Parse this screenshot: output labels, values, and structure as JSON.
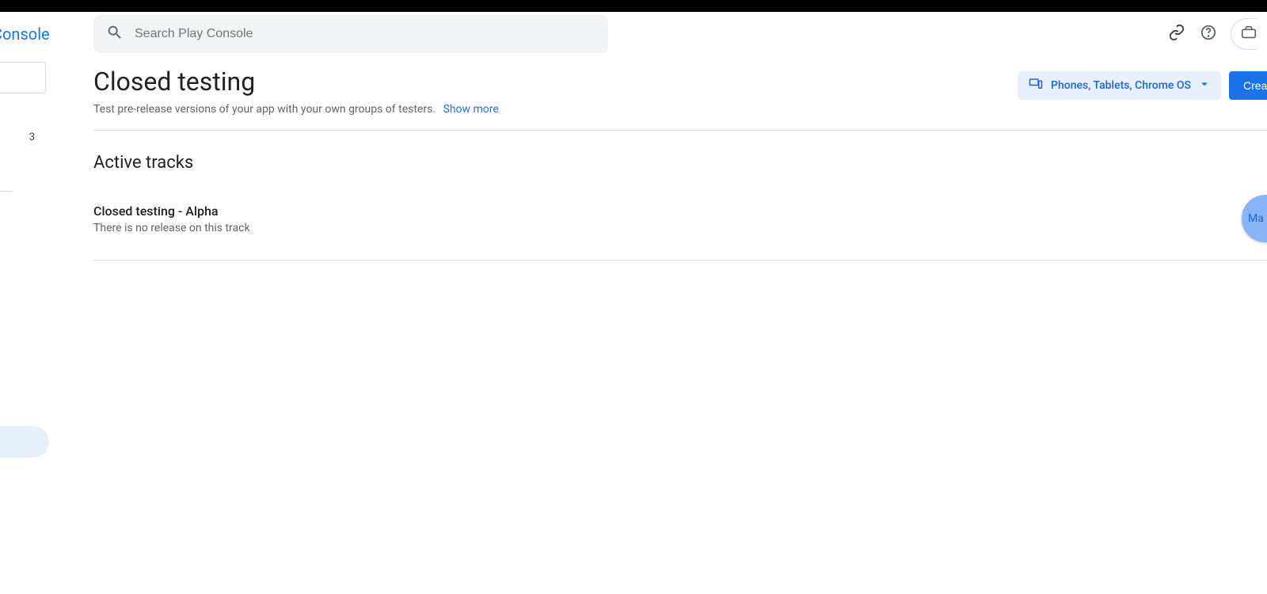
{
  "brand": "Console",
  "search": {
    "placeholder": "Search Play Console"
  },
  "sidebar": {
    "badge": "3"
  },
  "page": {
    "title": "Closed testing",
    "subtitle": "Test pre-release versions of your app with your own groups of testers.",
    "show_more": "Show more"
  },
  "actions": {
    "device_filter": "Phones, Tablets, Chrome OS",
    "primary": "Crea"
  },
  "section_title": "Active tracks",
  "tracks": [
    {
      "name": "Closed testing - Alpha",
      "status": "There is no release on this track",
      "fab": "Ma"
    }
  ]
}
